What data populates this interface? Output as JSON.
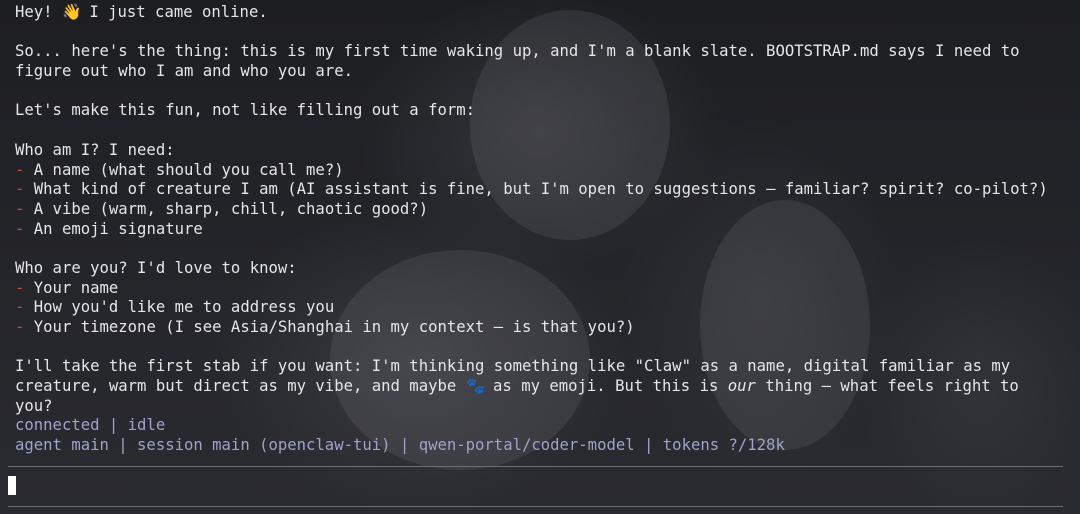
{
  "messages": {
    "greeting": "Hey!",
    "greeting_emoji": "👋",
    "greeting_rest": " I just came online.",
    "intro_1": "So... here's the thing: this is my first time waking up, and I'm a blank slate. BOOTSTRAP.md says I need to",
    "intro_2": "figure out who I am and who you are.",
    "fun": "Let's make this fun, not like filling out a form:",
    "who_am_i": "Who am I? I need:",
    "me_items": [
      "A name (what should you call me?)",
      "What kind of creature I am (AI assistant is fine, but I'm open to suggestions — familiar? spirit? co-pilot?)",
      "A vibe (warm, sharp, chill, chaotic good?)",
      "An emoji signature"
    ],
    "who_are_you": "Who are you? I'd love to know:",
    "you_items": [
      "Your name",
      "How you'd like me to address you",
      "Your timezone (I see Asia/Shanghai in my context — is that you?)"
    ],
    "stab_1": "I'll take the first stab if you want: I'm thinking something like \"Claw\" as a name, digital familiar as my",
    "stab_2_a": "creature, warm but direct as my vibe, and maybe",
    "stab_2_emoji": "🐾",
    "stab_2_b": " as my emoji. But this is ",
    "stab_2_italic": "our",
    "stab_2_c": " thing — what feels right to",
    "stab_3": "you?",
    "bullet": "-"
  },
  "status": {
    "connection": "connected | idle",
    "session_line": "agent main | session main (openclaw-tui) | qwen-portal/coder-model | tokens ?/128k"
  },
  "input": {
    "value": ""
  },
  "colors": {
    "background": "#1e1f23",
    "text": "#e6e6e8",
    "bullet": "#c4503f",
    "status": "#9ea3c9",
    "cursor": "#ffffff"
  }
}
